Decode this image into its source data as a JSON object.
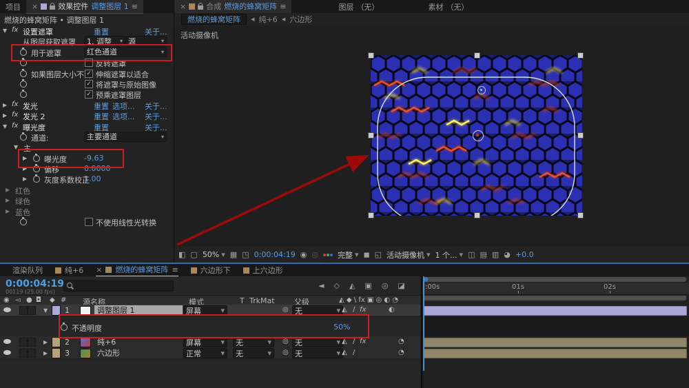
{
  "fx_panel": {
    "tab_project": "项目",
    "tab_effect_controls": "效果控件",
    "tab_effect_target": "调整图层 1",
    "breadcrumb": "燃烧的蜂窝矩阵 • 调整图层 1",
    "links": {
      "reset": "重置",
      "options": "选项...",
      "about": "关于..."
    },
    "set_matte": {
      "title": "设置遮罩",
      "take_from": "从图层获取遮罩",
      "take_from_value": "1. 调整",
      "source_value": "源",
      "use_for": "用于遮罩",
      "use_for_value": "红色通道",
      "invert": "反转遮罩",
      "if_sizes_differ": "如果图层大小不同",
      "stretch": "伸缩遮罩以适合",
      "composite": "将遮罩与原始图像",
      "premultiply": "预乘遮罩图层"
    },
    "glow1_title": "发光",
    "glow2_title": "发光 2",
    "exposure": {
      "title": "曝光度",
      "channel": "通道:",
      "channel_value": "主要通道",
      "master": "主",
      "exposure_label": "曝光度",
      "exposure_value": "-9.63",
      "offset_label": "偏移",
      "offset_value": "0.0000",
      "gamma_label": "灰度系数校正",
      "gamma_value": "1.00",
      "red": "红色",
      "green": "绿色",
      "blue": "蓝色",
      "bypass_linear": "不使用线性光转换"
    }
  },
  "comp_panel": {
    "tab_comp_label": "合成",
    "tab_comp_name": "燃烧的蜂窝矩阵",
    "tab_layer": "图层",
    "tab_layer_value": "（无）",
    "tab_footage": "素材",
    "tab_footage_value": "（无）",
    "nav": {
      "comp": "燃烧的蜂窝矩阵",
      "solid": "纯+6",
      "hex": "六边形"
    },
    "camera_label": "活动摄像机",
    "toolbar": {
      "zoom": "50%",
      "timecode": "0:00:04:19",
      "resolution": "完整",
      "camera": "活动摄像机",
      "views": "1 个...",
      "exposure": "+0.0"
    }
  },
  "timeline": {
    "tab_render_queue": "渲染队列",
    "tab_solid": "纯+6",
    "tab_comp": "燃烧的蜂窝矩阵",
    "tab_hex_down": "六边形下",
    "tab_hex_up": "上六边形",
    "timecode": "0:00:04:19",
    "frame_info": "00119 (25.00 fps)",
    "columns": {
      "source_name": "源名称",
      "mode": "模式",
      "t": "T",
      "trkmat": "TrkMat",
      "parent": "父级"
    },
    "layers": [
      {
        "num": "1",
        "name": "调整图层 1",
        "mode": "屏幕",
        "parent": "无"
      },
      {
        "num": "2",
        "name": "纯+6",
        "mode": "屏幕",
        "trkmat": "无",
        "parent": "无"
      },
      {
        "num": "3",
        "name": "六边形",
        "mode": "正常",
        "trkmat": "无",
        "parent": "无"
      }
    ],
    "opacity": {
      "label": "不透明度",
      "value": "50%"
    },
    "ruler": {
      "t0": ":00s",
      "t1": "01s",
      "t2": "02s"
    }
  }
}
